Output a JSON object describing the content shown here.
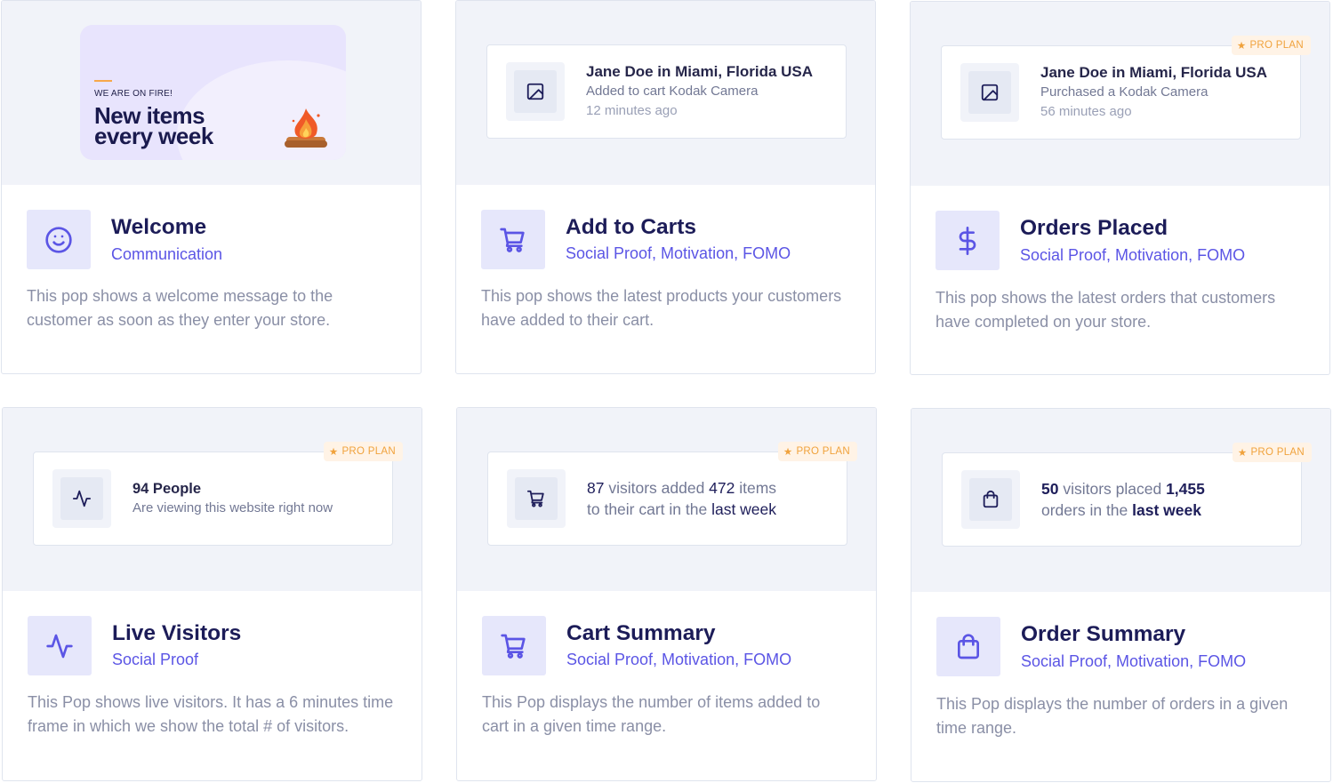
{
  "badge_label": "PRO PLAN",
  "colors": {
    "accent": "#5b55e5",
    "title": "#1c1c58",
    "pro_badge": "#f0a23c",
    "preview_bg": "#f1f3f9"
  },
  "cards": [
    {
      "title": "Welcome",
      "tags": "Communication",
      "description": "This pop shows a welcome message to the customer as soon as they enter your store.",
      "icon": "smile-icon",
      "banner": {
        "small_text": "WE ARE ON FIRE!",
        "line1": "New items",
        "line2": "every week",
        "icon": "fire-icon"
      }
    },
    {
      "title": "Add to Carts",
      "tags": "Social Proof, Motivation, FOMO",
      "description": "This pop shows the latest products your customers have added to their cart.",
      "icon": "cart-icon",
      "notification": {
        "name": "Jane Doe in Miami, Florida USA",
        "action": "Added to cart Kodak Camera",
        "time": "12 minutes ago",
        "icon": "image-icon"
      }
    },
    {
      "title": "Orders Placed",
      "tags": "Social Proof, Motivation, FOMO",
      "description": "This pop shows the latest orders that customers have completed on your store.",
      "icon": "dollar-icon",
      "notification": {
        "name": "Jane Doe in Miami, Florida USA",
        "action": "Purchased a Kodak Camera",
        "time": "56 minutes ago",
        "icon": "image-icon"
      }
    },
    {
      "title": "Live Visitors",
      "tags": "Social Proof",
      "description": "This Pop shows live visitors. It has a 6 minutes time frame in which we show the total # of visitors.",
      "icon": "activity-icon",
      "notification": {
        "count": "94 People",
        "text": "Are viewing this website right now",
        "icon": "activity-icon"
      }
    },
    {
      "title": "Cart Summary",
      "tags": "Social Proof, Motivation, FOMO",
      "description": "This Pop displays the number of items added to cart in a given time range.",
      "icon": "cart-icon",
      "notification": {
        "n1": "87",
        "t1": " visitors added ",
        "n2": "472",
        "t2": " items",
        "t3": "to their cart in the ",
        "period": "last week",
        "icon": "cart-icon"
      }
    },
    {
      "title": "Order Summary",
      "tags": "Social Proof, Motivation, FOMO",
      "description": "This Pop displays the number of orders in a given time range.",
      "icon": "shopping-bag-icon",
      "notification": {
        "n1": "50",
        "t1": " visitors placed ",
        "n2": "1,455",
        "t3": "orders in the ",
        "period": "last week",
        "icon": "shopping-bag-icon"
      }
    }
  ]
}
